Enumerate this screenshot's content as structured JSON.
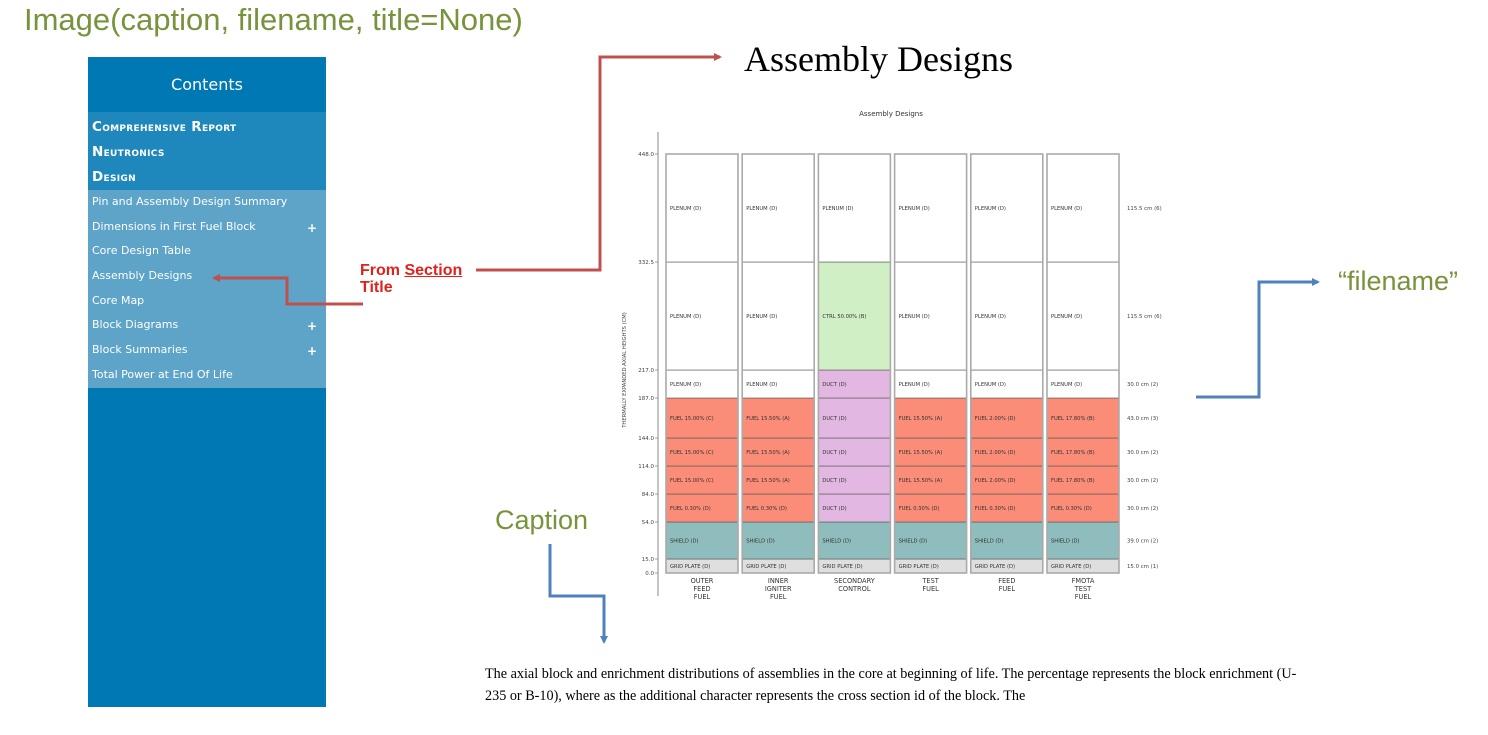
{
  "annotations": {
    "signature": "Image(caption, filename, title=None)",
    "from_section_prefix": "From ",
    "from_section_link": "Section",
    "from_section_suffix": "Title",
    "filename_label": "“filename”",
    "caption_label": "Caption",
    "colors": {
      "green": "#77933c",
      "red": "#e0211c",
      "blue_arrow": "#4f81bd",
      "red_arrow": "#c0504d"
    }
  },
  "sidebar": {
    "header": "Contents",
    "top_items": [
      {
        "label": "Comprehensive Report"
      },
      {
        "label": "Neutronics"
      },
      {
        "label": "Design"
      }
    ],
    "sub_items": [
      {
        "label": "Pin and Assembly Design Summary",
        "expandable": false
      },
      {
        "label": "Dimensions in First Fuel Block",
        "expandable": true
      },
      {
        "label": "Core Design Table",
        "expandable": false
      },
      {
        "label": "Assembly Designs",
        "expandable": false
      },
      {
        "label": "Core Map",
        "expandable": false
      },
      {
        "label": "Block Diagrams",
        "expandable": true
      },
      {
        "label": "Block Summaries",
        "expandable": true
      },
      {
        "label": "Total Power at End Of Life",
        "expandable": false
      }
    ],
    "expand_glyph": "+"
  },
  "page": {
    "title": "Assembly Designs",
    "caption": "The axial block and enrichment distributions of assemblies in the core at beginning of life. The percentage represents the block enrichment (U-235 or B-10), where as the additional character represents the cross section id of the block. The"
  },
  "chart_data": {
    "type": "stacked-block-diagram",
    "title": "Assembly Designs",
    "ylabel": "THERMALLY EXPANDED AXIAL HEIGHTS (CM)",
    "y_ticks": [
      "0.0",
      "15.0",
      "54.0",
      "84.0",
      "114.0",
      "144.0",
      "187.0",
      "217.0",
      "332.5",
      "448.0"
    ],
    "block_boundaries": [
      0.0,
      15.0,
      54.0,
      84.0,
      114.0,
      144.0,
      187.0,
      217.0,
      332.5,
      448.0
    ],
    "right_labels": [
      "15.0 cm (1)",
      "39.0 cm (2)",
      "30.0 cm (2)",
      "30.0 cm (2)",
      "30.0 cm (2)",
      "43.0 cm (3)",
      "30.0 cm (2)",
      "115.5 cm (6)",
      "115.5 cm (6)"
    ],
    "type_colors": {
      "GRID PLATE": "#dfdfdf",
      "SHIELD": "#8fbcbc",
      "FUEL": "#fa8c78",
      "DUCT": "#e2b8e2",
      "CTRL": "#d0efc4",
      "PLENUM": "#ffffff"
    },
    "assemblies": [
      {
        "name": [
          "OUTER",
          "FEED",
          "FUEL"
        ],
        "blocks": [
          "GRID PLATE (D)",
          "SHIELD (D)",
          "FUEL 0.30% (D)",
          "FUEL 15.00% (C)",
          "FUEL 15.00% (C)",
          "FUEL 15.00% (C)",
          "PLENUM (D)",
          "PLENUM (D)",
          "PLENUM (D)"
        ]
      },
      {
        "name": [
          "INNER",
          "IGNITER",
          "FUEL"
        ],
        "blocks": [
          "GRID PLATE (D)",
          "SHIELD (D)",
          "FUEL 0.30% (D)",
          "FUEL 15.50% (A)",
          "FUEL 15.50% (A)",
          "FUEL 15.50% (A)",
          "PLENUM (D)",
          "PLENUM (D)",
          "PLENUM (D)"
        ]
      },
      {
        "name": [
          "SECONDARY",
          "CONTROL"
        ],
        "blocks": [
          "GRID PLATE (D)",
          "SHIELD (D)",
          "DUCT (D)",
          "DUCT (D)",
          "DUCT (D)",
          "DUCT (D)",
          "DUCT (D)",
          "CTRL 50.00% (B)",
          "PLENUM (D)"
        ]
      },
      {
        "name": [
          "TEST",
          "FUEL"
        ],
        "blocks": [
          "GRID PLATE (D)",
          "SHIELD (D)",
          "FUEL 0.30% (D)",
          "FUEL 15.50% (A)",
          "FUEL 15.50% (A)",
          "FUEL 15.50% (A)",
          "PLENUM (D)",
          "PLENUM (D)",
          "PLENUM (D)"
        ]
      },
      {
        "name": [
          "FEED",
          "FUEL"
        ],
        "blocks": [
          "GRID PLATE (D)",
          "SHIELD (D)",
          "FUEL 0.30% (D)",
          "FUEL 2.00% (D)",
          "FUEL 2.00% (D)",
          "FUEL 2.00% (D)",
          "PLENUM (D)",
          "PLENUM (D)",
          "PLENUM (D)"
        ]
      },
      {
        "name": [
          "FMOTA",
          "TEST",
          "FUEL"
        ],
        "blocks": [
          "GRID PLATE (D)",
          "SHIELD (D)",
          "FUEL 0.30% (D)",
          "FUEL 17.80% (B)",
          "FUEL 17.80% (B)",
          "FUEL 17.80% (B)",
          "PLENUM (D)",
          "PLENUM (D)",
          "PLENUM (D)"
        ]
      }
    ]
  }
}
